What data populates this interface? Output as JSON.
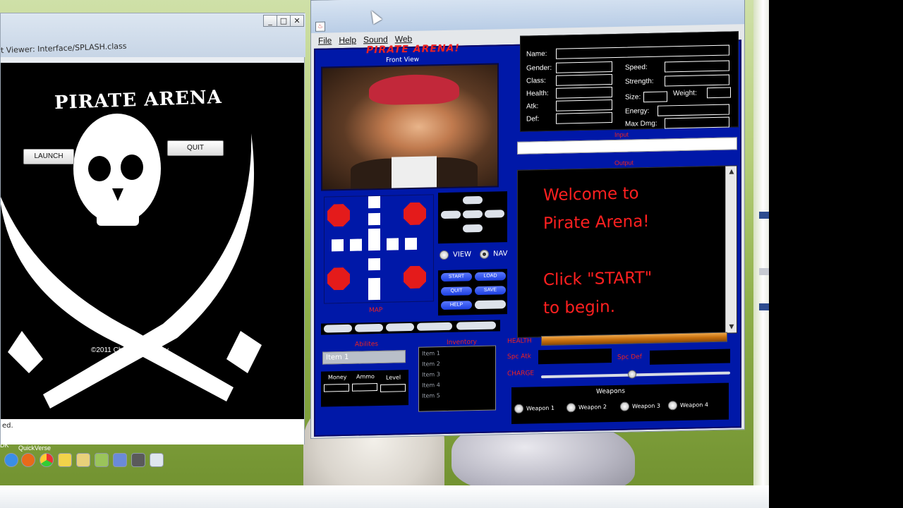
{
  "splash": {
    "window_title": "t Viewer: Interface/SPLASH.class",
    "heading": "PIRATE ARENA",
    "launch_label": "LAUNCH",
    "quit_label": "QUIT",
    "credit": "©2011 Charles Germany",
    "status": "ed.",
    "minimize_glyph": "_",
    "maximize_glyph": "□",
    "close_glyph": "✕"
  },
  "desktop": {
    "label_dk": "DK",
    "label_quickverse": "QuickVerse"
  },
  "app": {
    "menu": [
      "File",
      "Help",
      "Sound",
      "Web"
    ],
    "brand": "PIRATE ARENA!",
    "front_view_label": "Front View",
    "java_glyph": "♨",
    "stats": {
      "name": "Name:",
      "gender": "Gender:",
      "class": "Class:",
      "health": "Health:",
      "atk": "Atk:",
      "def": "Def:",
      "speed": "Speed:",
      "strength": "Strength:",
      "size": "Size:",
      "weight": "Weight:",
      "energy": "Energy:",
      "max_dmg": "Max Dmg:"
    },
    "input_label": "Input",
    "output_label": "Output",
    "output_text": "Welcome to\nPirate Arena!\n\nClick \"START\"\nto begin.",
    "scroll_up": "▲",
    "scroll_down": "▼",
    "map_label": "MAP",
    "view_label": "VIEW",
    "nav_label": "NAV",
    "actions": {
      "start": "START",
      "load": "LOAD",
      "quit": "QUIT",
      "save": "SAVE",
      "help": "HELP"
    },
    "abilities_label": "Abilites",
    "abilities_selected": "Item 1",
    "inventory_label": "Inventory",
    "inventory_items": [
      "Item 1",
      "Item 2",
      "Item 3",
      "Item 4",
      "Item 5"
    ],
    "money_label": "Money",
    "ammo_label": "Ammo",
    "level_label": "Level",
    "health_label": "HEALTH",
    "health_fraction": 1.0,
    "spc_atk_label": "Spc Atk",
    "spc_def_label": "Spc Def",
    "charge_label": "CHARGE",
    "charge_fraction": 0.48,
    "weapons_title": "Weapons",
    "weapons": [
      "Weapon 1",
      "Weapon 2",
      "Weapon 3",
      "Weapon 4"
    ]
  },
  "colors": {
    "app_panel": "#0018a8",
    "accent_red": "#ff2020",
    "health_orange": "#e08a2a"
  }
}
